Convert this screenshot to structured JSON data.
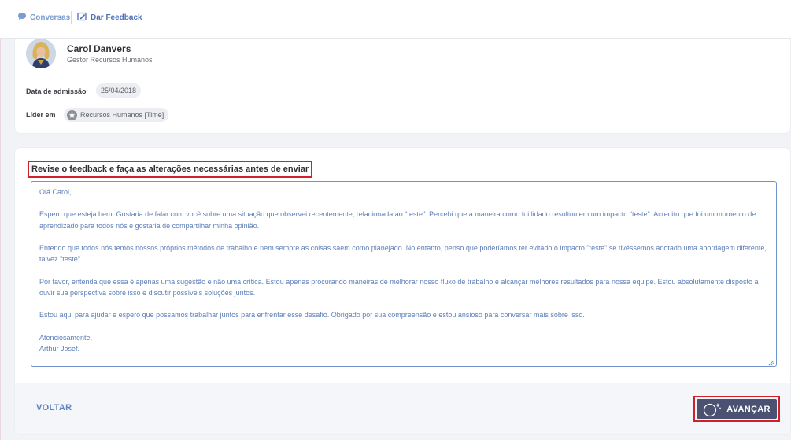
{
  "topbar": {
    "breadcrumbs": [
      {
        "label": "Conversas",
        "icon": "chat-bubble-icon"
      },
      {
        "label": "Dar Feedback",
        "icon": "edit-feedback-icon"
      }
    ]
  },
  "profile": {
    "name": "Carol Danvers",
    "role": "Gestor Recursos Humanos",
    "admission_label": "Data de admissão",
    "admission_date": "25/04/2018",
    "leader_label": "Líder em",
    "leader_team": "Recursos Humanos [Time]"
  },
  "review": {
    "title": "Revise o feedback e faça as alterações necessárias antes de enviar",
    "message": {
      "greeting": "Olá Carol,",
      "p1": "Espero que esteja bem. Gostaria de falar com você sobre uma situação que observei recentemente, relacionada ao \"teste\". Percebi que a maneira como foi lidado resultou em um impacto \"teste\". Acredito que foi um momento de aprendizado para todos nós e gostaria de compartilhar minha opinião.",
      "p2": "Entendo que todos nós temos nossos próprios métodos de trabalho e nem sempre as coisas saem como planejado. No entanto, penso que poderíamos ter evitado o impacto \"teste\" se tivéssemos adotado uma abordagem diferente, talvez \"teste\".",
      "p3": "Por favor, entenda que essa é apenas uma sugestão e não uma crítica. Estou apenas procurando maneiras de melhorar nosso fluxo de trabalho e alcançar melhores resultados para nossa equipe. Estou absolutamente disposto a ouvir sua perspectiva sobre isso e discutir possíveis soluções juntos.",
      "p4": "Estou aqui para ajudar e espero que possamos trabalhar juntos para enfrentar esse desafio. Obrigado por sua compreensão e estou ansioso para conversar mais sobre isso.",
      "closing": "Atenciosamente,",
      "signature": "Arthur Josef."
    }
  },
  "footer": {
    "back_label": "VOLTAR",
    "next_label": "AVANÇAR",
    "next_icon": "ai-sparkle-icon",
    "ai_badge": "AI"
  },
  "colors": {
    "accent": "#4b5170",
    "link": "#5d83c5",
    "highlight": "#d0202a",
    "text_blue": "#5d7fb8"
  }
}
